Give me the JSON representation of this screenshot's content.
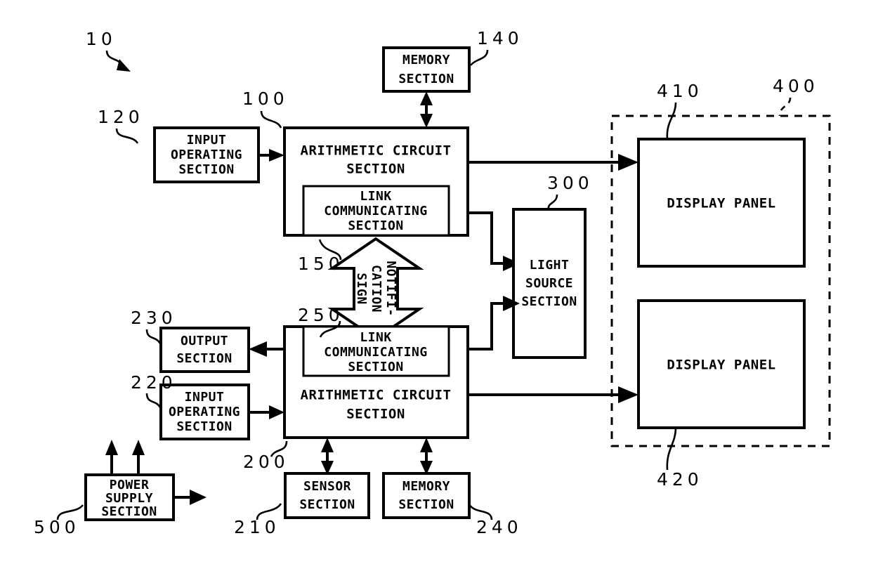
{
  "figure": {
    "id": "10",
    "type": "patent-block-diagram",
    "title": "Display system block diagram"
  },
  "blocks": {
    "input_operating_top": {
      "ref": "120",
      "lines": [
        "INPUT",
        "OPERATING",
        "SECTION"
      ]
    },
    "arithmetic_top": {
      "ref": "100",
      "lines": [
        "ARITHMETIC CIRCUIT",
        "SECTION"
      ]
    },
    "link_top": {
      "ref": "150",
      "lines": [
        "LINK",
        "COMMUNICATING",
        "SECTION"
      ]
    },
    "memory_top": {
      "ref": "140",
      "lines": [
        "MEMORY",
        "SECTION"
      ]
    },
    "light_source": {
      "ref": "300",
      "lines": [
        "LIGHT",
        "SOURCE",
        "SECTION"
      ]
    },
    "display_container": {
      "ref": "400"
    },
    "display_panel_top": {
      "ref": "410",
      "lines": [
        "DISPLAY PANEL"
      ]
    },
    "display_panel_bottom": {
      "ref": "420",
      "lines": [
        "DISPLAY PANEL"
      ]
    },
    "output_bottom": {
      "ref": "230",
      "lines": [
        "OUTPUT",
        "SECTION"
      ]
    },
    "input_operating_bottom": {
      "ref": "220",
      "lines": [
        "INPUT",
        "OPERATING",
        "SECTION"
      ]
    },
    "link_bottom": {
      "ref": "250",
      "lines": [
        "LINK",
        "COMMUNICATING",
        "SECTION"
      ]
    },
    "arithmetic_bottom": {
      "ref": "200",
      "lines": [
        "ARITHMETIC CIRCUIT",
        "SECTION"
      ]
    },
    "sensor_bottom": {
      "ref": "210",
      "lines": [
        "SENSOR",
        "SECTION"
      ]
    },
    "memory_bottom": {
      "ref": "240",
      "lines": [
        "MEMORY",
        "SECTION"
      ]
    },
    "power_supply": {
      "ref": "500",
      "lines": [
        "POWER",
        "SUPPLY",
        "SECTION"
      ]
    }
  },
  "notification_sign": {
    "lines": [
      "NOTIFI-",
      "CATION",
      "SIGN"
    ]
  },
  "colors": {
    "stroke": "#000000",
    "fill": "#ffffff"
  }
}
